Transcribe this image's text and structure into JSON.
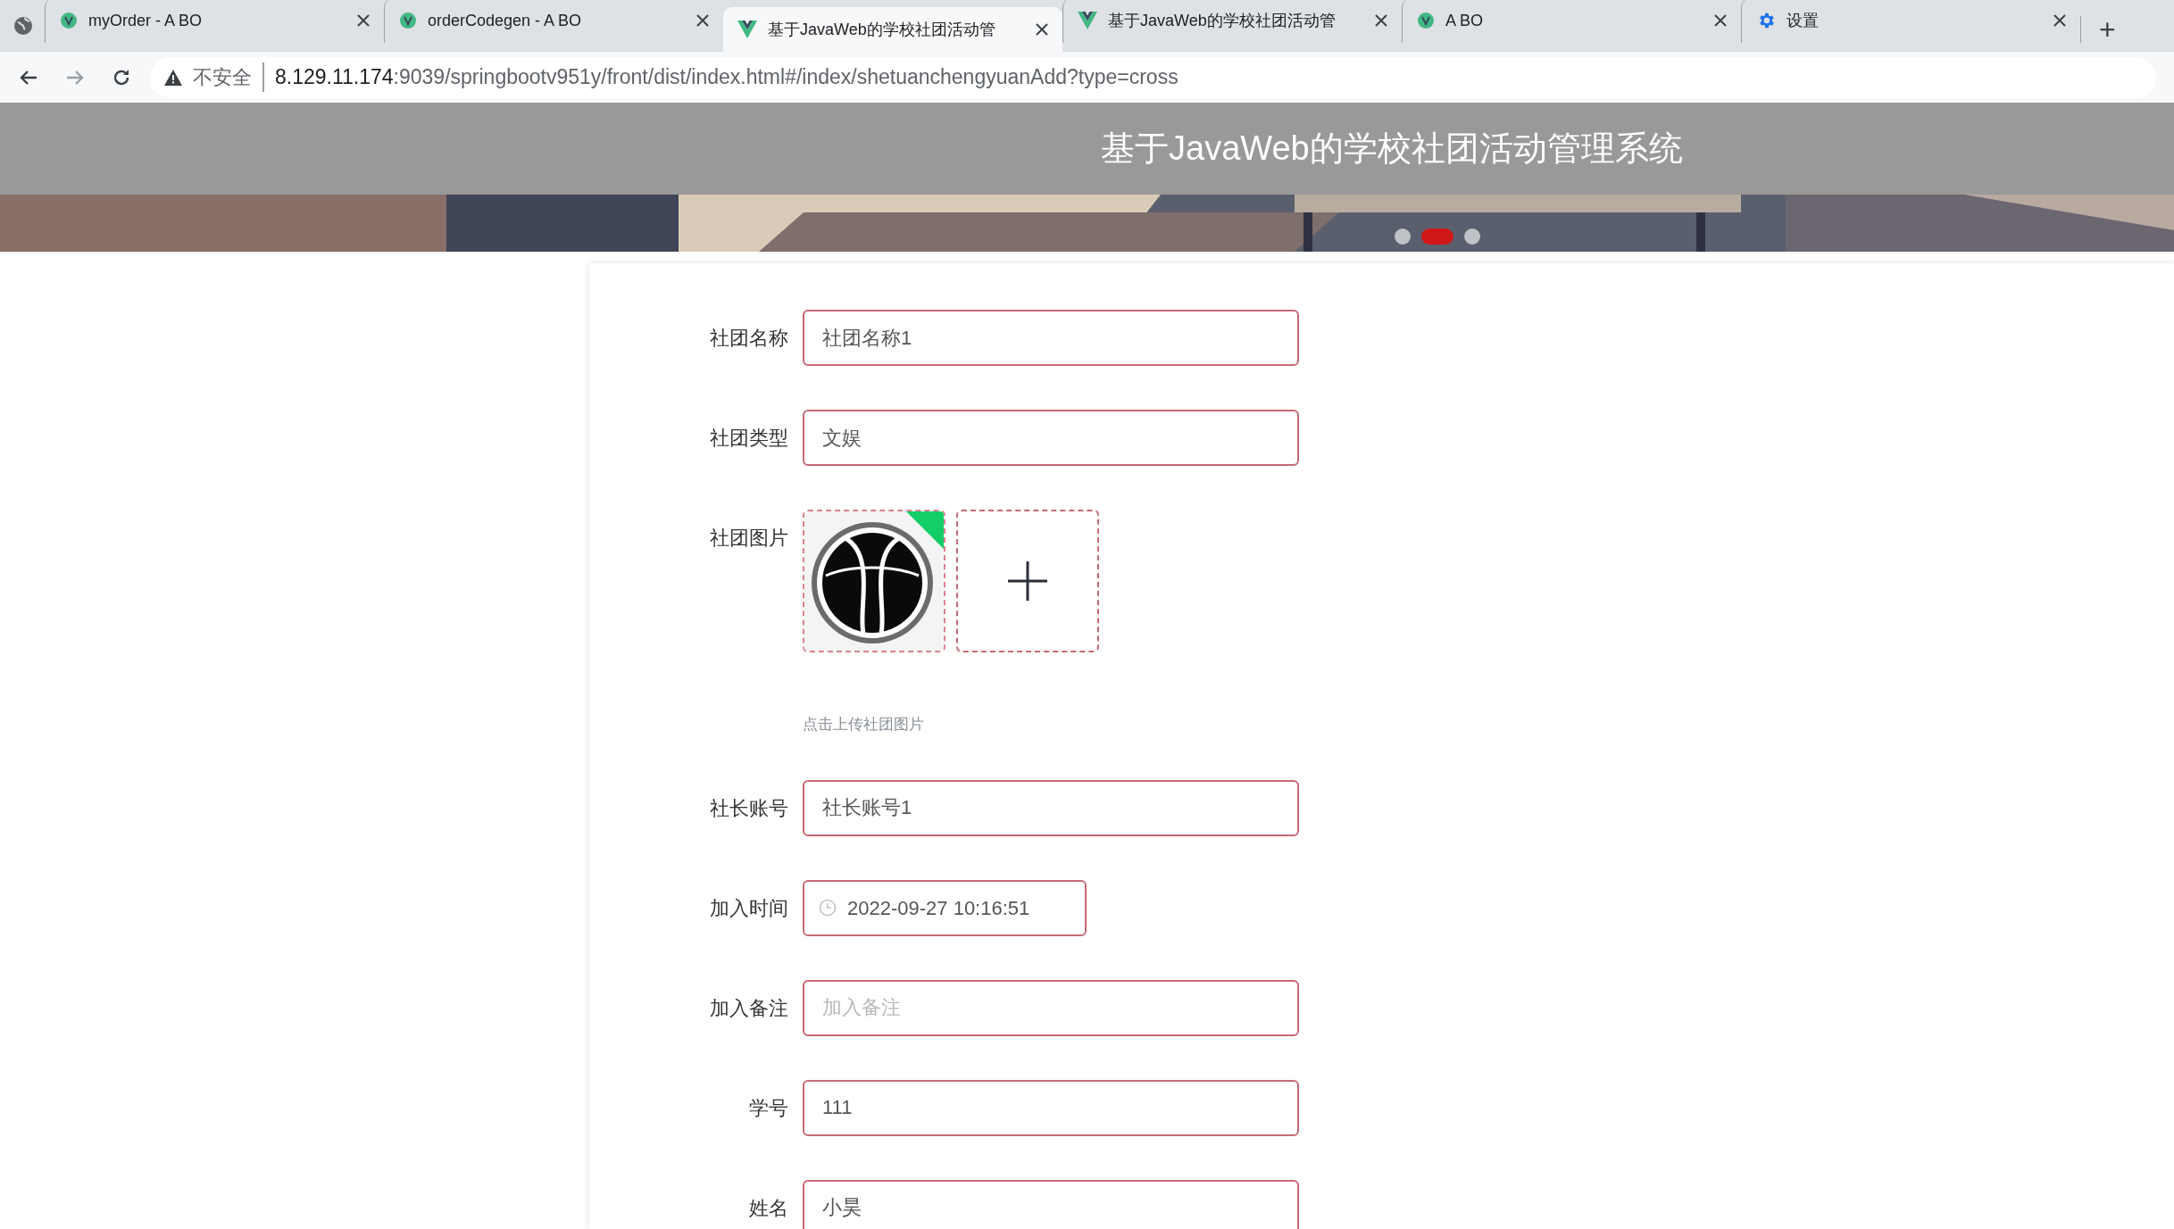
{
  "browser": {
    "tabs": [
      {
        "kind": "vue",
        "title": "myOrder - A BO",
        "selected": false
      },
      {
        "kind": "vue",
        "title": "orderCodegen - A BO",
        "selected": false
      },
      {
        "kind": "vue-v",
        "title": "基于JavaWeb的学校社团活动管",
        "selected": true
      },
      {
        "kind": "vue-v",
        "title": "基于JavaWeb的学校社团活动管",
        "selected": false
      },
      {
        "kind": "vue",
        "title": "A BO",
        "selected": false
      },
      {
        "kind": "settings",
        "title": "设置",
        "selected": false
      }
    ],
    "new_tab": "+",
    "security_label": "不安全",
    "url_host": "8.129.11.174",
    "url_rest": ":9039/springbootv951y/front/dist/index.html#/index/shetuanchengyuanAdd?type=cross"
  },
  "header": {
    "title": "基于JavaWeb的学校社团活动管理系统"
  },
  "carousel": {
    "dots": [
      {
        "selected": false
      },
      {
        "selected": true
      },
      {
        "selected": false
      }
    ]
  },
  "form": {
    "fields": [
      {
        "kind": "text",
        "label": "社团名称",
        "value": "社团名称1"
      },
      {
        "kind": "text",
        "label": "社团类型",
        "value": "文娱"
      },
      {
        "kind": "upload",
        "label": "社团图片",
        "hint": "点击上传社团图片",
        "images": [
          {
            "kind": "picture",
            "uploaded": true
          }
        ]
      },
      {
        "kind": "text",
        "label": "社长账号",
        "value": "社长账号1"
      },
      {
        "kind": "datetime",
        "label": "加入时间",
        "value": "2022-09-27 10:16:51"
      },
      {
        "kind": "text",
        "label": "加入备注",
        "placeholder": "加入备注"
      },
      {
        "kind": "text",
        "label": "学号",
        "value": "111"
      },
      {
        "kind": "text",
        "label": "姓名",
        "value": "小昊"
      }
    ]
  }
}
